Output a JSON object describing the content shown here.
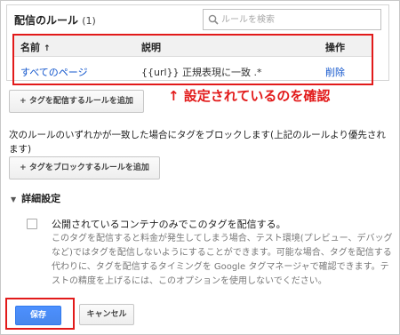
{
  "rules_panel": {
    "title": "配信のルール",
    "count": "(1)",
    "search_placeholder": "ルールを検索",
    "columns": {
      "name": "名前",
      "description": "説明",
      "action": "操作"
    },
    "sort_indicator": "↑",
    "rows": [
      {
        "name": "すべてのページ",
        "description": "{{url}} 正規表現に一致 .*",
        "action": "削除"
      }
    ]
  },
  "add_firing_rule_button": "+ タグを配信するルールを追加",
  "annotation": "↑ 設定されているのを確認",
  "blocking": {
    "description": "次のルールのいずれかが一致した場合にタグをブロックします(上記のルールより優先されます)",
    "add_button": "+ タグをブロックするルールを追加"
  },
  "advanced": {
    "toggle_label": "詳細設定",
    "checkbox_label": "公開されているコンテナのみでこのタグを配信する。",
    "checkbox_checked": false,
    "help_text": "このタグを配信すると料金が発生してしまう場合、テスト環境(プレビュー、デバッグなど)ではタグを配信しないようにすることができます。可能な場合、タグを配信する代わりに、タグを配信するタイミングを Google タグマネージャで確認できます。テストの精度を上げるには、このオプションを使用しないでください。"
  },
  "footer": {
    "save_label": "保存",
    "cancel_label": "キャンセル"
  },
  "colors": {
    "highlight": "#e21a1a",
    "link": "#1155cc",
    "primary": "#4d90fe"
  }
}
